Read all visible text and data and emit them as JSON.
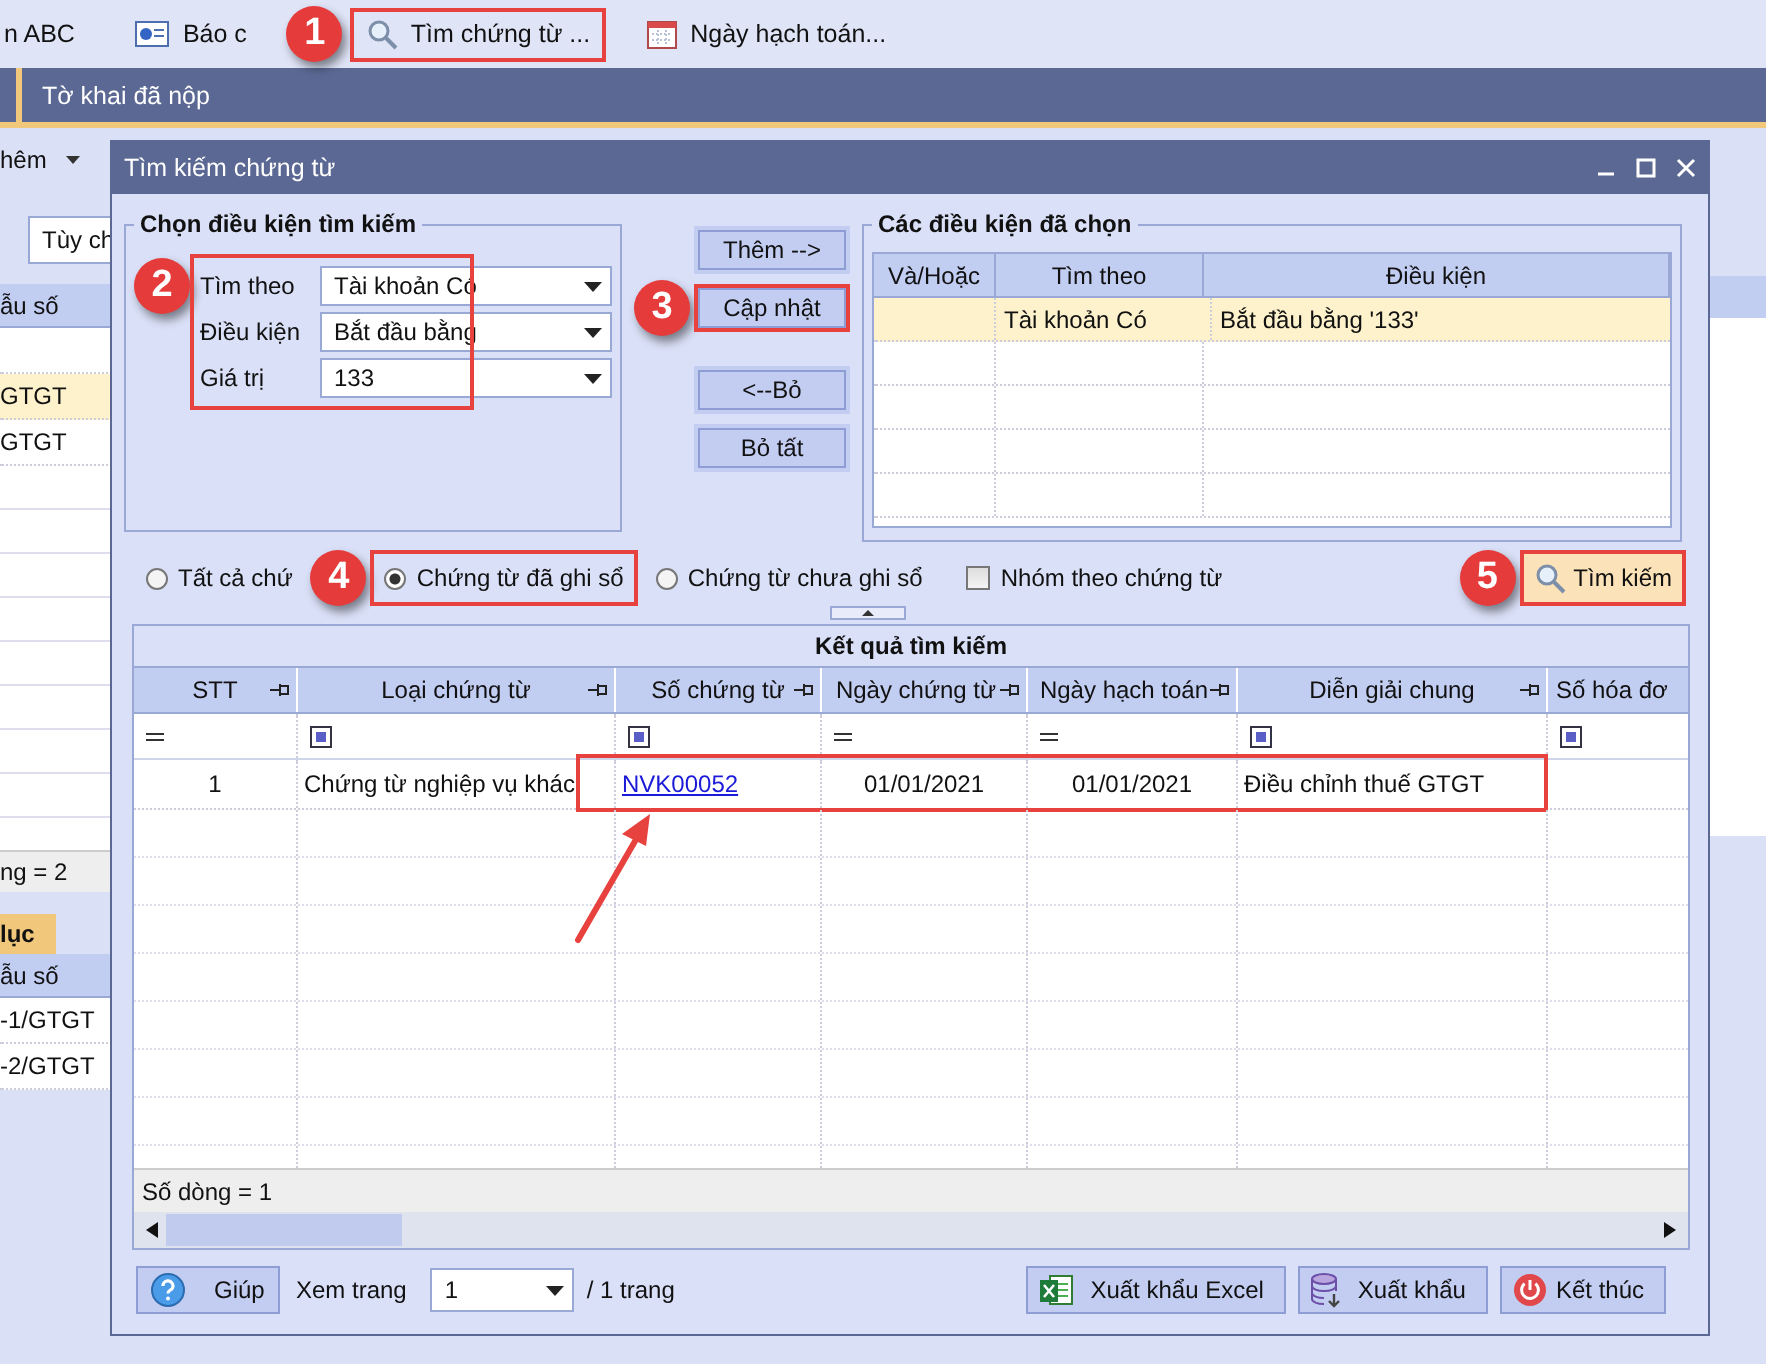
{
  "toolbar": {
    "items": [
      {
        "label": "n ABC",
        "highlighted": false
      },
      {
        "label": "Báo c",
        "highlighted": false
      },
      {
        "label": "Tìm chứng từ ...",
        "highlighted": true,
        "callout": "1"
      },
      {
        "label": "Ngày hạch toán...",
        "highlighted": false
      }
    ]
  },
  "tabs": [
    {
      "label": "Tờ khai đã nộp",
      "selected": true
    }
  ],
  "background_panel": {
    "filter_label": "hêm",
    "option_field": "Tùy ch",
    "upper_grid": {
      "column": "ẫu số",
      "rows": [
        {
          "value": "GTGT",
          "selected": true
        },
        {
          "value": "GTGT",
          "selected": false
        }
      ],
      "footer": "ng = 2"
    },
    "lower_tab": "lục",
    "lower_grid": {
      "column": "ẫu số",
      "rows": [
        {
          "value": "-1/GTGT"
        },
        {
          "value": "-2/GTGT"
        }
      ]
    }
  },
  "dialog": {
    "title": "Tìm kiếm chứng từ",
    "criteria": {
      "title": "Chọn điều kiện tìm kiếm",
      "highlighted": true,
      "callout": "2",
      "fields": [
        {
          "label": "Tìm theo",
          "value": "Tài khoản Có"
        },
        {
          "label": "Điều kiện",
          "value": "Bắt đầu bằng"
        },
        {
          "label": "Giá trị",
          "value": "133"
        }
      ]
    },
    "actions": [
      {
        "label": "Thêm -->",
        "highlighted": false
      },
      {
        "label": "Cập nhật",
        "highlighted": true,
        "callout": "3"
      },
      {
        "label": "<--Bỏ",
        "highlighted": false
      },
      {
        "label": "Bỏ tất",
        "highlighted": false
      }
    ],
    "chosen": {
      "title": "Các điều kiện đã chọn",
      "columns": [
        "Và/Hoặc",
        "Tìm theo",
        "Điều kiện"
      ],
      "rows": [
        {
          "find_by": "Tài khoản Có",
          "condition": "Bắt đầu bằng '133'",
          "selected": true
        }
      ]
    },
    "options": [
      {
        "kind": "radio",
        "label": "Tất cả chứ",
        "selected": false,
        "highlighted": false
      },
      {
        "kind": "radio",
        "label": "Chứng từ đã ghi sổ",
        "selected": true,
        "highlighted": true,
        "callout": "4"
      },
      {
        "kind": "radio",
        "label": "Chứng từ chưa ghi sổ",
        "selected": false,
        "highlighted": false
      },
      {
        "kind": "checkbox",
        "label": "Nhóm theo chứng từ",
        "checked": false,
        "highlighted": false
      }
    ],
    "search_button": {
      "label": "Tìm kiếm",
      "highlighted": true,
      "callout": "5"
    },
    "results": {
      "title": "Kết quả tìm kiếm",
      "columns": [
        {
          "label": "STT"
        },
        {
          "label": "Loại chứng từ"
        },
        {
          "label": "Số chứng từ",
          "kind": "link"
        },
        {
          "label": "Ngày chứng từ"
        },
        {
          "label": "Ngày hạch toán"
        },
        {
          "label": "Diễn giải chung"
        },
        {
          "label": "Số hóa đơ"
        }
      ],
      "rows": [
        {
          "cells": [
            "1",
            "Chứng từ nghiệp vụ khác",
            "NVK00052",
            "01/01/2021",
            "01/01/2021",
            "Điều chỉnh thuế GTGT"
          ],
          "highlighted": true
        }
      ],
      "footer": "Số dòng = 1"
    },
    "bottom": {
      "help": "Giúp",
      "page_label": "Xem trang",
      "page": "1",
      "page_total": "/ 1 trang",
      "buttons": [
        {
          "label": "Xuất khẩu Excel"
        },
        {
          "label": "Xuất khẩu"
        },
        {
          "label": "Kết thúc"
        }
      ]
    }
  }
}
